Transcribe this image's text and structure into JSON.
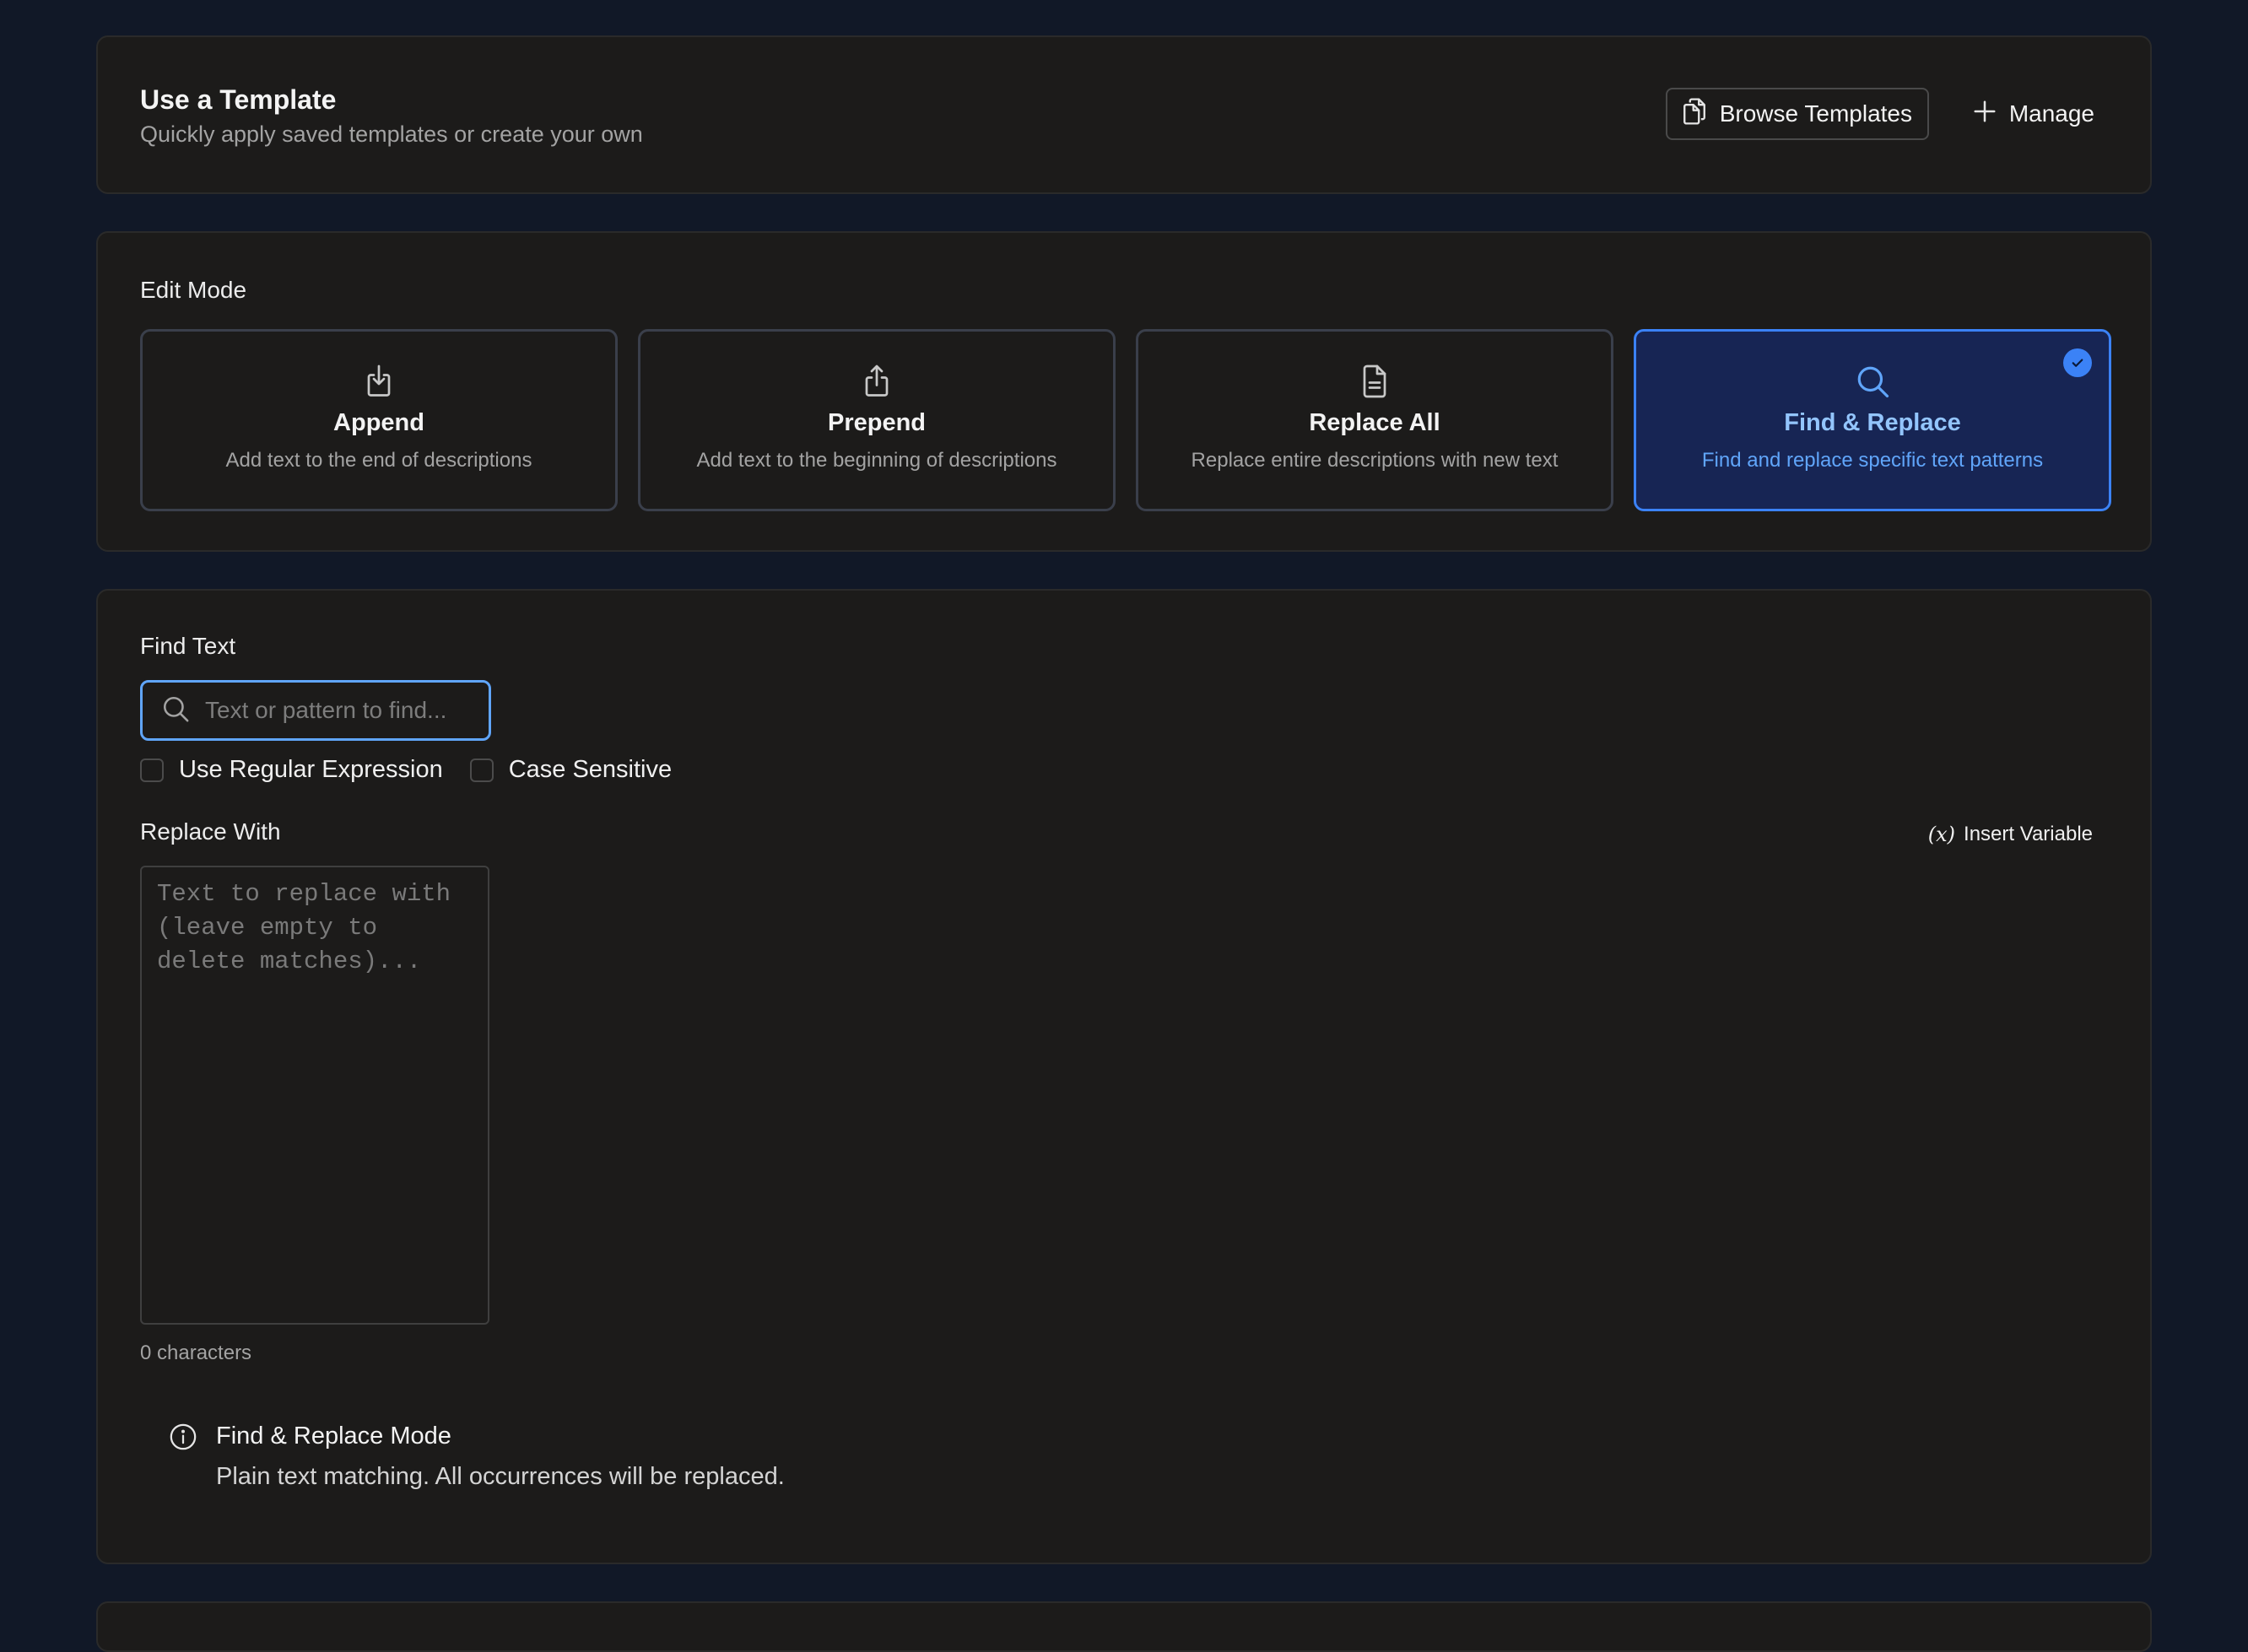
{
  "template": {
    "title": "Use a Template",
    "subtitle": "Quickly apply saved templates or create your own",
    "browse_label": "Browse Templates",
    "manage_label": "Manage"
  },
  "edit_mode": {
    "label": "Edit Mode",
    "selected": "Find & Replace",
    "modes": [
      {
        "title": "Append",
        "description": "Add text to the end of descriptions",
        "icon": "download-icon"
      },
      {
        "title": "Prepend",
        "description": "Add text to the beginning of descriptions",
        "icon": "share-icon"
      },
      {
        "title": "Replace All",
        "description": "Replace entire descriptions with new text",
        "icon": "document-icon"
      },
      {
        "title": "Find & Replace",
        "description": "Find and replace specific text patterns",
        "icon": "search-icon"
      }
    ]
  },
  "find": {
    "label": "Find Text",
    "value": "",
    "placeholder": "Text or pattern to find..."
  },
  "options": {
    "regex_label": "Use Regular Expression",
    "regex_checked": false,
    "case_label": "Case Sensitive",
    "case_checked": false
  },
  "replace": {
    "label": "Replace With",
    "insert_variable_label": "Insert Variable",
    "value": "",
    "placeholder": "Text to replace with (leave empty to delete matches)...",
    "char_count": "0 characters"
  },
  "info": {
    "title": "Find & Replace Mode",
    "text": "Plain text matching. All occurrences will be replaced."
  },
  "colors": {
    "background": "#111827",
    "card": "#1c1b1a",
    "accent": "#3b82f6",
    "selected_fill": "#172554"
  }
}
